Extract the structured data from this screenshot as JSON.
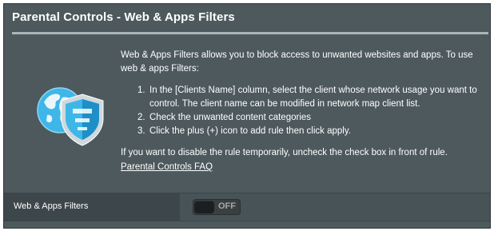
{
  "panel": {
    "title": "Parental Controls - Web & Apps Filters"
  },
  "description": {
    "intro": "Web & Apps Filters allows you to block access to unwanted websites and apps. To use web & apps Filters:",
    "steps": [
      {
        "num": "1.",
        "text": "In the [Clients Name] column, select the client whose network usage you want to control. The client name can be modified in network map client list."
      },
      {
        "num": "2.",
        "text": "Check the unwanted content categories"
      },
      {
        "num": "3.",
        "text": "Click the plus (+) icon to add rule then click apply."
      }
    ],
    "note": "If you want to disable the rule temporarily, uncheck the check box in front of rule.",
    "faq_link": "Parental Controls FAQ"
  },
  "setting": {
    "label": "Web & Apps Filters",
    "toggle_state": "OFF"
  },
  "icons": {
    "logo": "globe-shield-icon"
  },
  "colors": {
    "panel_bg": "#4d595d",
    "rule": "#a8b5ba",
    "logo_blue": "#3fb6e8"
  }
}
